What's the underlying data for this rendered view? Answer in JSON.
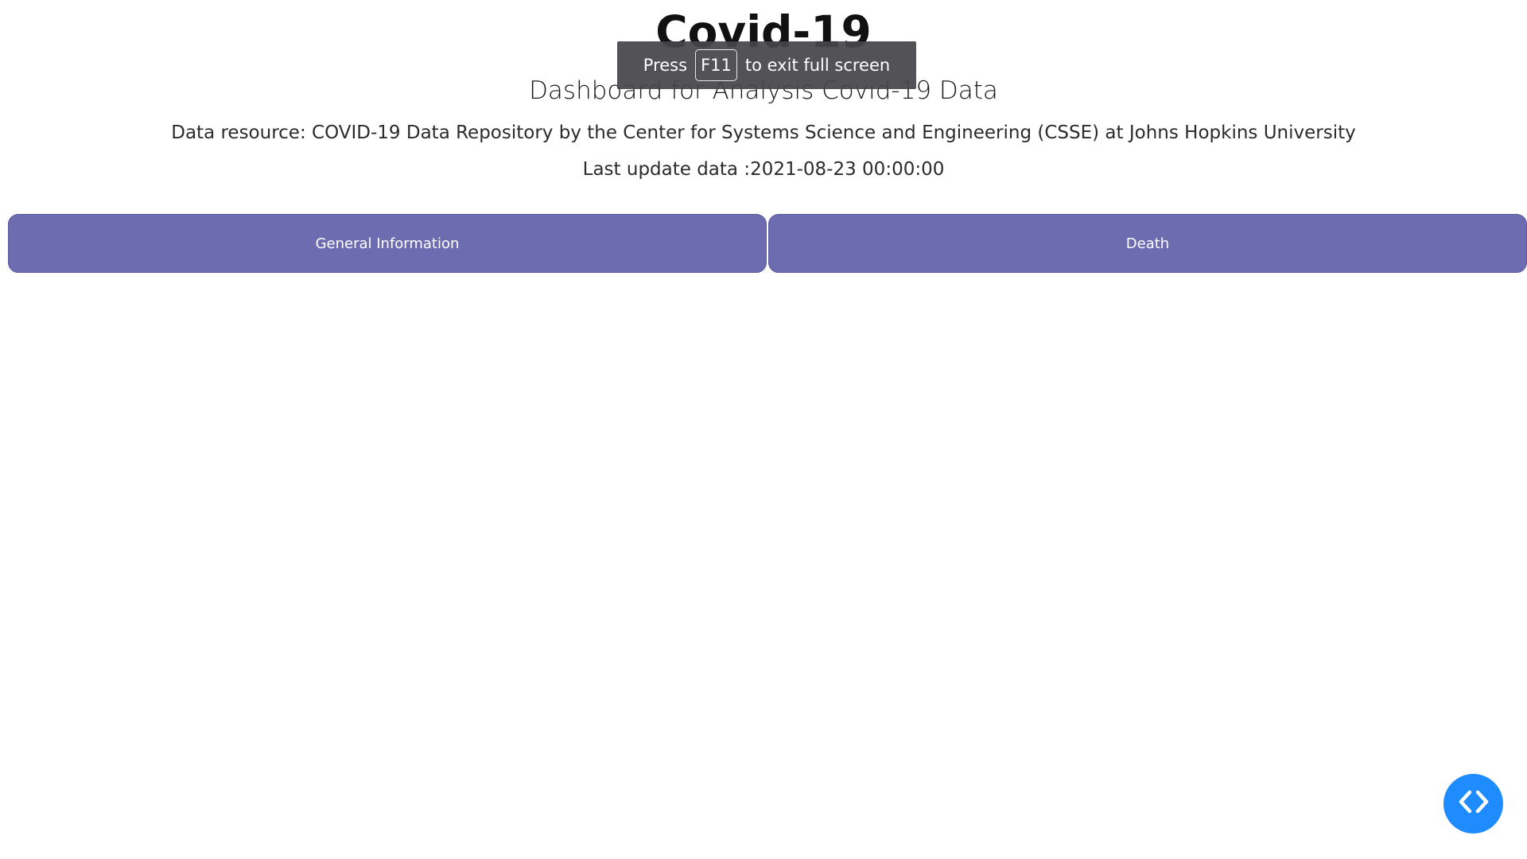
{
  "header": {
    "title": "Covid-19",
    "subtitle": "Dashboard for Analysis Covid-19 Data",
    "data_resource": "Data resource: COVID-19 Data Repository by the Center for Systems Science and Engineering (CSSE) at Johns Hopkins University",
    "last_update": "Last update data :2021-08-23 00:00:00"
  },
  "tabs": [
    {
      "label": "General Information"
    },
    {
      "label": "Death"
    }
  ],
  "fullscreen_toast": {
    "prefix": "Press",
    "key": "F11",
    "suffix": "to exit full screen"
  },
  "dev_button": {
    "icon": "code-brackets-icon"
  },
  "colors": {
    "tab_background": "#6e6cb0",
    "dev_button": "#1e8bff",
    "toast_background": "#46464a"
  }
}
